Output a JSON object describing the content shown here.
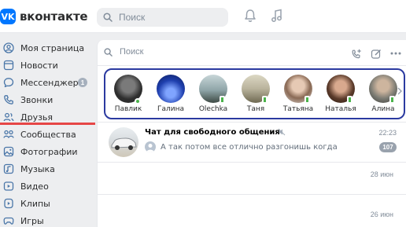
{
  "header": {
    "logo_letter": "VK",
    "logo_text": "вконтакте",
    "search_placeholder": "Поиск",
    "icons": [
      "bell-icon",
      "music-icon"
    ]
  },
  "sidebar": {
    "items": [
      {
        "label": "Моя страница",
        "icon": "profile-icon"
      },
      {
        "label": "Новости",
        "icon": "news-icon"
      },
      {
        "label": "Мессенджер",
        "icon": "chat-bubble-icon",
        "badge": "1"
      },
      {
        "label": "Звонки",
        "icon": "phone-icon"
      },
      {
        "label": "Друзья",
        "icon": "friends-icon"
      },
      {
        "label": "Сообщества",
        "icon": "communities-icon"
      },
      {
        "label": "Фотографии",
        "icon": "photo-icon"
      },
      {
        "label": "Музыка",
        "icon": "music-icon"
      },
      {
        "label": "Видео",
        "icon": "video-icon"
      },
      {
        "label": "Клипы",
        "icon": "clips-icon"
      },
      {
        "label": "Игры",
        "icon": "games-icon"
      }
    ]
  },
  "messenger": {
    "search_placeholder": "Поиск",
    "tools": [
      "add-call-icon",
      "compose-icon",
      "more-icon"
    ],
    "stories": [
      {
        "name": "Павлик",
        "status": "online",
        "color": "#3a3a3a"
      },
      {
        "name": "Галина",
        "status": "none",
        "color": "#1f3fae"
      },
      {
        "name": "Olechka",
        "status": "mobile",
        "color": "#8fa5a8"
      },
      {
        "name": "Таня",
        "status": "mobile",
        "color": "#b9b39c"
      },
      {
        "name": "Татьяна",
        "status": "mobile",
        "color": "#c9b8a8"
      },
      {
        "name": "Наталья",
        "status": "mobile",
        "color": "#5a3a2a"
      },
      {
        "name": "Алина",
        "status": "mobile",
        "color": "#7a7a72"
      }
    ],
    "chat": {
      "title": "Чат для свободного общения",
      "time": "22:23",
      "preview": "А так потом все отлично разгонишь когда",
      "unread": "107"
    },
    "dates": [
      "28 июн",
      "26 июн"
    ],
    "colors": {
      "accent": "#0077ff",
      "online": "#4bb34b",
      "highlight_border": "#2b3aa0",
      "underline": "#e64646"
    }
  }
}
